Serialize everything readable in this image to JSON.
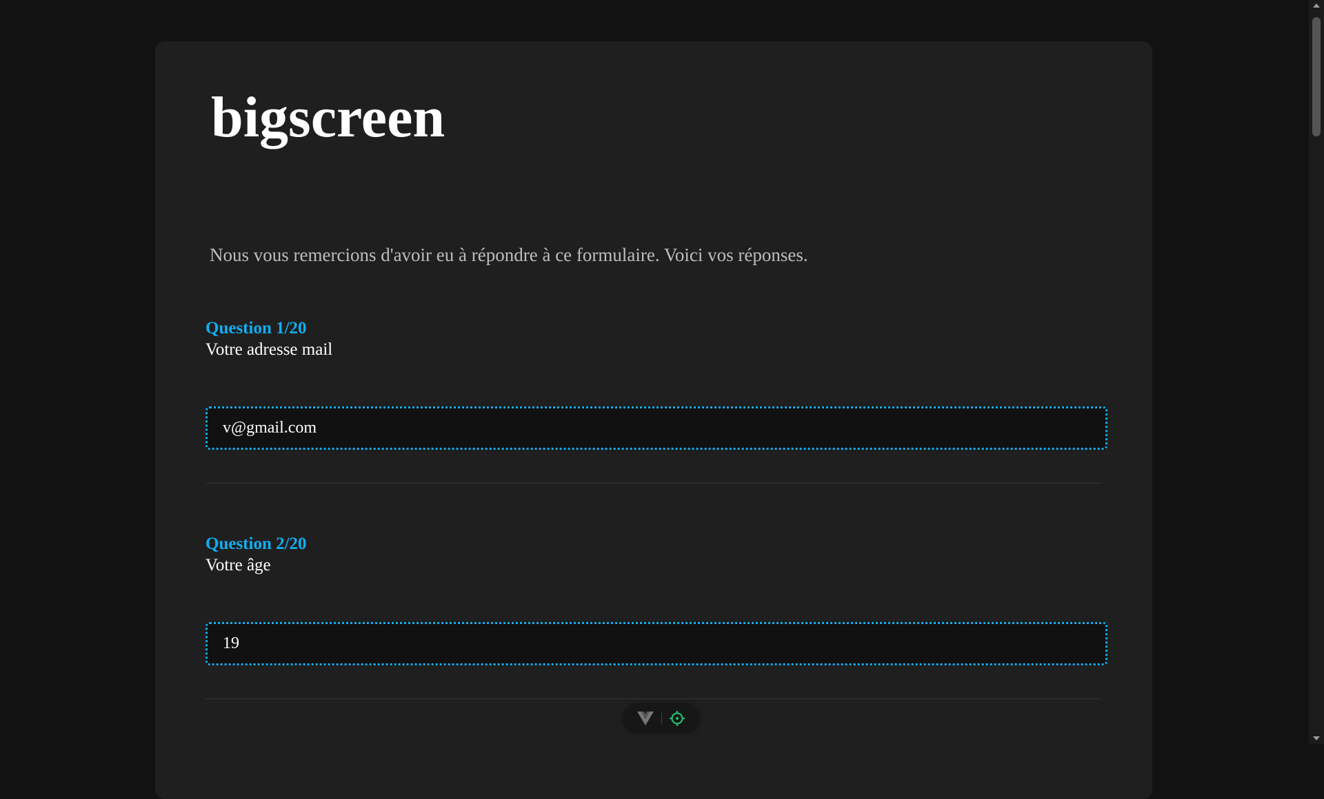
{
  "title": "bigscreen",
  "intro": "Nous vous remercions d'avoir eu à répondre à ce formulaire. Voici vos réponses.",
  "questions": [
    {
      "label": "Question 1/20",
      "text": "Votre adresse mail",
      "answer": "v@gmail.com"
    },
    {
      "label": "Question 2/20",
      "text": "Votre âge",
      "answer": "19"
    }
  ],
  "toolbar": {
    "icons": [
      "vue-logo-icon",
      "target-icon"
    ]
  },
  "colors": {
    "accent": "#10aef0",
    "target": "#1fc06a"
  }
}
